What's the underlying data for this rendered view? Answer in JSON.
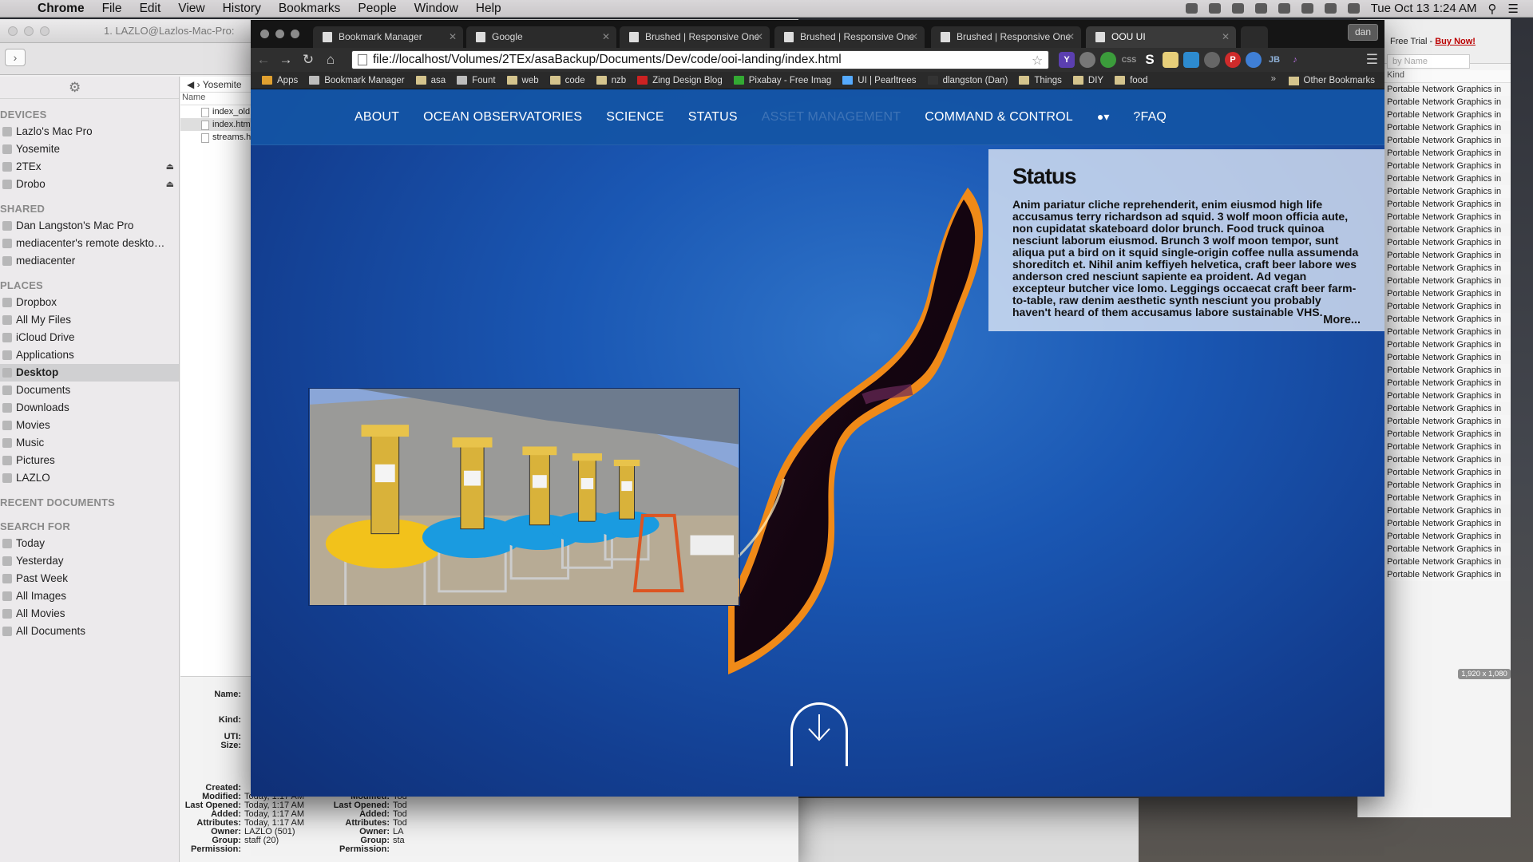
{
  "menubar": {
    "app_name": "Chrome",
    "items": [
      "File",
      "Edit",
      "View",
      "History",
      "Bookmarks",
      "People",
      "Window",
      "Help"
    ],
    "clock": "Tue Oct 13  1:24 AM"
  },
  "finder": {
    "window_title": "1. LAZLO@Lazlos-Mac-Pro:",
    "sidebar": {
      "devices_header": "DEVICES",
      "devices": [
        "Lazlo's Mac Pro",
        "Yosemite",
        "2TEx",
        "Drobo"
      ],
      "shared_header": "SHARED",
      "shared": [
        "Dan Langston's Mac Pro",
        "mediacenter's remote deskto…",
        "mediacenter"
      ],
      "places_header": "PLACES",
      "places": [
        "Dropbox",
        "All My Files",
        "iCloud Drive",
        "Applications",
        "Desktop",
        "Documents",
        "Downloads",
        "Movies",
        "Music",
        "Pictures",
        "LAZLO"
      ],
      "active_place": "Desktop",
      "recent_header": "RECENT DOCUMENTS",
      "search_header": "SEARCH FOR",
      "searches": [
        "Today",
        "Yesterday",
        "Past Week",
        "All Images",
        "All Movies",
        "All Documents"
      ]
    },
    "path_label": "Yosemite",
    "name_header": "Name",
    "files": [
      "index_old",
      "index.htm",
      "streams.h"
    ],
    "info": {
      "name_label": "Name:",
      "kind_label": "Kind:",
      "uti_label": "UTI:",
      "size_label": "Size:",
      "created_label": "Created:",
      "modified_label": "Modified:",
      "modified_value": "Today, 1:17 AM",
      "last_opened_label": "Last Opened:",
      "last_opened_value": "Today, 1:17 AM",
      "added_label": "Added:",
      "added_value": "Today, 1:17 AM",
      "attributes_label": "Attributes:",
      "attributes_value": "Today, 1:17 AM",
      "owner_label": "Owner:",
      "owner_value": "LAZLO (501)",
      "group_label": "Group:",
      "group_value": "staff (20)",
      "permission_label": "Permission:",
      "col2_modified": "Tod",
      "col2_last_opened": "Tod",
      "col2_added": "Tod",
      "col2_attributes": "Tod",
      "col2_owner": "LA",
      "col2_group": "sta"
    }
  },
  "background_window": {
    "trial_text": "Free Trial - ",
    "buy_now": "Buy Now!",
    "search_placeholder": "by Name",
    "kind_header": "Kind",
    "kind_value": "Portable Network Graphics in",
    "dimensions_badge": "1,920 x 1,080"
  },
  "chrome": {
    "profile": "dan",
    "tabs": [
      {
        "label": "Bookmark Manager"
      },
      {
        "label": "Google"
      },
      {
        "label": "Brushed | Responsive One"
      },
      {
        "label": "Brushed | Responsive One"
      },
      {
        "label": "Brushed | Responsive One"
      },
      {
        "label": "OOU UI"
      }
    ],
    "url": "file://localhost/Volumes/2TEx/asaBackup/Documents/Dev/code/ooi-landing/index.html",
    "bookmarks": [
      "Apps",
      "Bookmark Manager",
      "asa",
      "Fount",
      "web",
      "code",
      "nzb",
      "Zing Design Blog",
      "Pixabay - Free Imag",
      "UI | Pearltrees",
      "dlangston (Dan)",
      "Things",
      "DIY",
      "food"
    ],
    "other_bookmarks": "Other Bookmarks",
    "more": "»"
  },
  "site": {
    "nav": [
      "ABOUT",
      "OCEAN OBSERVATORIES",
      "SCIENCE",
      "STATUS",
      "ASSET MANAGEMENT",
      "COMMAND & CONTROL"
    ],
    "user_caret": "▾",
    "faq": "?FAQ",
    "status": {
      "title": "Status",
      "body": "Anim pariatur cliche reprehenderit, enim eiusmod high life accusamus terry richardson ad squid. 3 wolf moon officia aute, non cupidatat skateboard dolor brunch. Food truck quinoa nesciunt laborum eiusmod. Brunch 3 wolf moon tempor, sunt aliqua put a bird on it squid single-origin coffee nulla assumenda shoreditch et. Nihil anim keffiyeh helvetica, craft beer labore wes anderson cred nesciunt sapiente ea proident. Ad vegan excepteur butcher vice lomo. Leggings occaecat craft beer farm-to-table, raw denim aesthetic synth nesciunt you probably haven't heard of them accusamus labore sustainable VHS.",
      "more": "More..."
    }
  },
  "colors": {
    "page_blue": "#1a57b3",
    "nav_bar": "#1455a5",
    "buoy_yellow": "#f2c21b",
    "buoy_blue": "#1a9be0",
    "link_red": "#b00000"
  }
}
